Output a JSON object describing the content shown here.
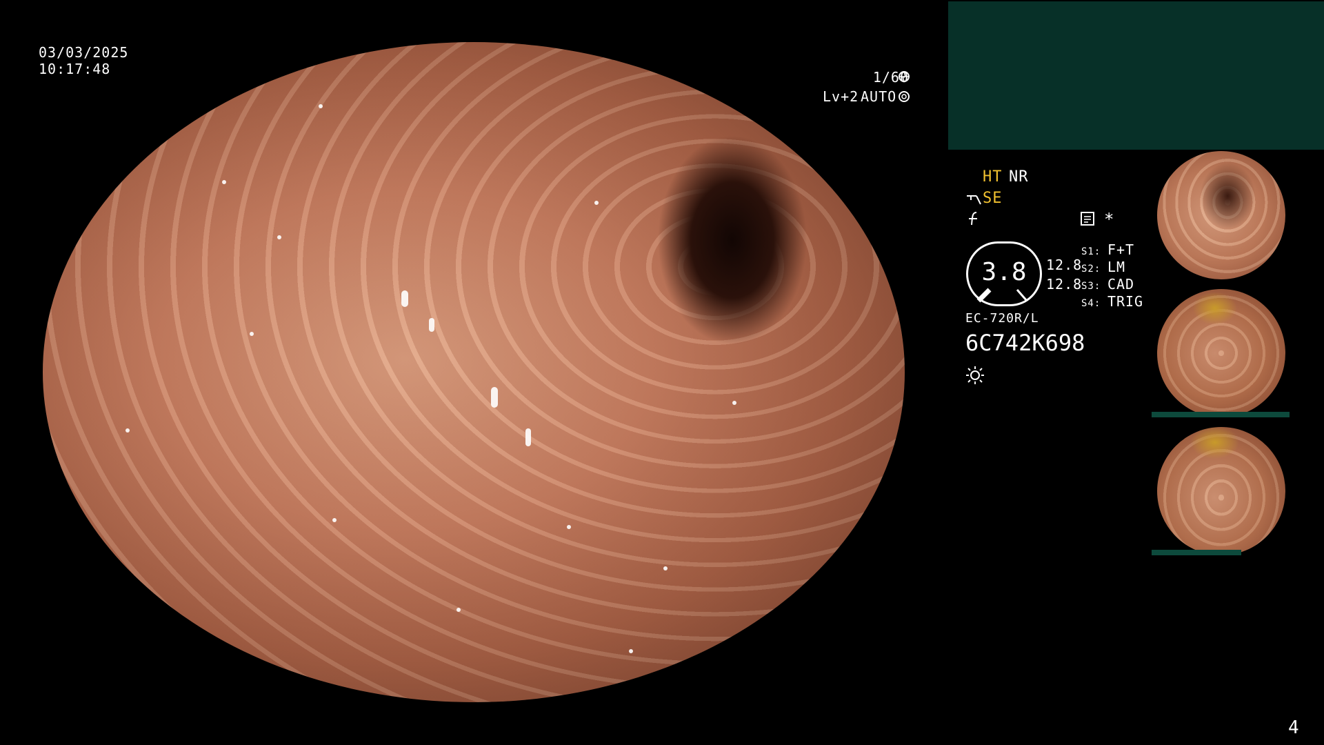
{
  "overlay": {
    "date": "03/03/2025",
    "time": "10:17:48",
    "shutter": "1/60",
    "shutter_icon": "aperture-icon",
    "level": "Lv+2",
    "mode": "AUTO",
    "mode_icon": "iris-icon"
  },
  "panel": {
    "ht": "HT",
    "nr": "NR",
    "se": "SE",
    "se_icon": "scope-tip-icon",
    "f_icon": "f-script-icon",
    "record_icon": "memo-icon",
    "asterisk": "*",
    "level_value": "3.8",
    "readout_top": "12.8",
    "readout_bottom": "12.8",
    "switches": [
      {
        "key": "S1:",
        "value": "F+T"
      },
      {
        "key": "S2:",
        "value": "LM"
      },
      {
        "key": "S3:",
        "value": "CAD"
      },
      {
        "key": "S4:",
        "value": "TRIG"
      }
    ],
    "scope_model": "EC-720R/L",
    "serial": "6C742K698",
    "light_icon": "light-sun-icon"
  },
  "page_number": "4",
  "colors": {
    "accent_yellow": "#f2c230",
    "panel_green": "#073028",
    "background": "#000000"
  }
}
